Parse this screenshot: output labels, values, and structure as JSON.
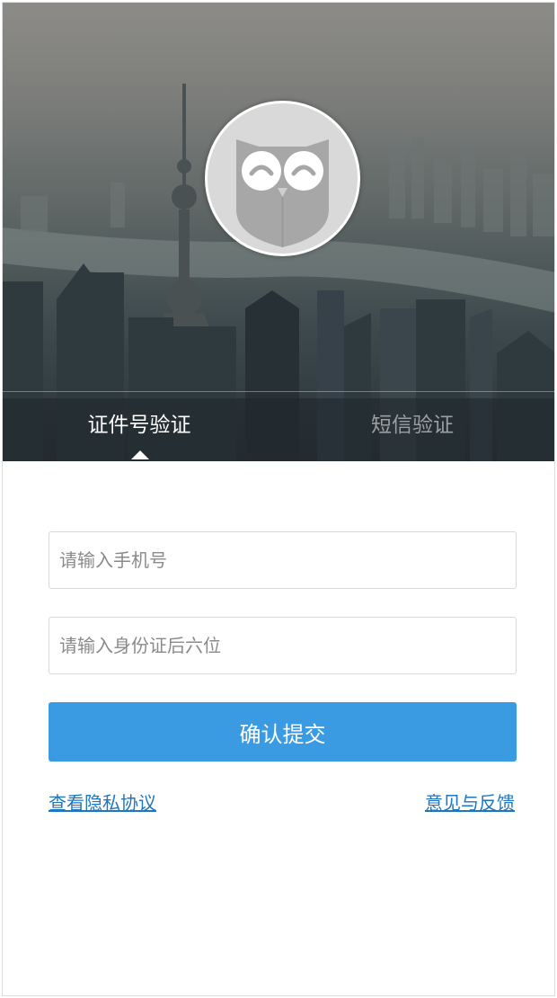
{
  "tabs": {
    "id_verify": "证件号验证",
    "sms_verify": "短信验证"
  },
  "form": {
    "phone_placeholder": "请输入手机号",
    "id_placeholder": "请输入身份证后六位",
    "submit_label": "确认提交"
  },
  "links": {
    "privacy": "查看隐私协议",
    "feedback": "意见与反馈"
  },
  "colors": {
    "primary_button": "#3a9be3",
    "link": "#1f76c0",
    "active_tab": "#ffffff",
    "inactive_tab": "#9ca0a2"
  },
  "icons": {
    "avatar": "owl-logo-icon"
  },
  "background_image": "city-skyline-photo"
}
